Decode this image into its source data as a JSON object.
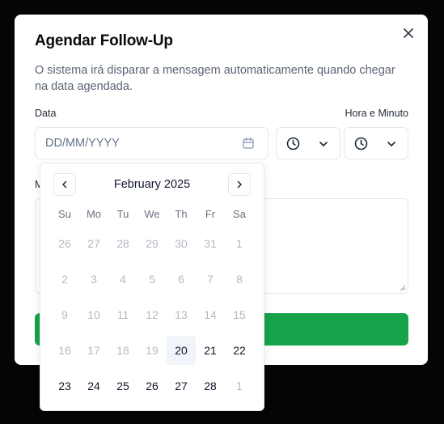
{
  "dialog": {
    "title": "Agendar Follow-Up",
    "description": "O sistema irá disparar a mensagem automaticamente quando chegar na data agendada.",
    "close_icon": "x-icon"
  },
  "form": {
    "date_label": "Data",
    "date_placeholder": "DD/MM/YYYY",
    "time_label": "Hora e Minuto",
    "message_label": "M",
    "submit_label": ""
  },
  "calendar": {
    "month_label": "February 2025",
    "weekdays": [
      "Su",
      "Mo",
      "Tu",
      "We",
      "Th",
      "Fr",
      "Sa"
    ],
    "weeks": [
      [
        {
          "d": "26",
          "s": "dim"
        },
        {
          "d": "27",
          "s": "dim"
        },
        {
          "d": "28",
          "s": "dim"
        },
        {
          "d": "29",
          "s": "dim"
        },
        {
          "d": "30",
          "s": "dim"
        },
        {
          "d": "31",
          "s": "dim"
        },
        {
          "d": "1",
          "s": "dim"
        }
      ],
      [
        {
          "d": "2",
          "s": "dim"
        },
        {
          "d": "3",
          "s": "dim"
        },
        {
          "d": "4",
          "s": "dim"
        },
        {
          "d": "5",
          "s": "dim"
        },
        {
          "d": "6",
          "s": "dim"
        },
        {
          "d": "7",
          "s": "dim"
        },
        {
          "d": "8",
          "s": "dim"
        }
      ],
      [
        {
          "d": "9",
          "s": "dim"
        },
        {
          "d": "10",
          "s": "dim"
        },
        {
          "d": "11",
          "s": "dim"
        },
        {
          "d": "12",
          "s": "dim"
        },
        {
          "d": "13",
          "s": "dim"
        },
        {
          "d": "14",
          "s": "dim"
        },
        {
          "d": "15",
          "s": "dim"
        }
      ],
      [
        {
          "d": "16",
          "s": "dim"
        },
        {
          "d": "17",
          "s": "dim"
        },
        {
          "d": "18",
          "s": "dim"
        },
        {
          "d": "19",
          "s": "dim"
        },
        {
          "d": "20",
          "s": "today"
        },
        {
          "d": "21",
          "s": "active"
        },
        {
          "d": "22",
          "s": "active"
        }
      ],
      [
        {
          "d": "23",
          "s": "active"
        },
        {
          "d": "24",
          "s": "active"
        },
        {
          "d": "25",
          "s": "active"
        },
        {
          "d": "26",
          "s": "active"
        },
        {
          "d": "27",
          "s": "active"
        },
        {
          "d": "28",
          "s": "active"
        },
        {
          "d": "1",
          "s": "dim"
        }
      ]
    ]
  },
  "colors": {
    "overlay": "#050505",
    "accent_green": "#16a34a",
    "border": "#e2e8f0",
    "muted_text": "#64748b"
  }
}
